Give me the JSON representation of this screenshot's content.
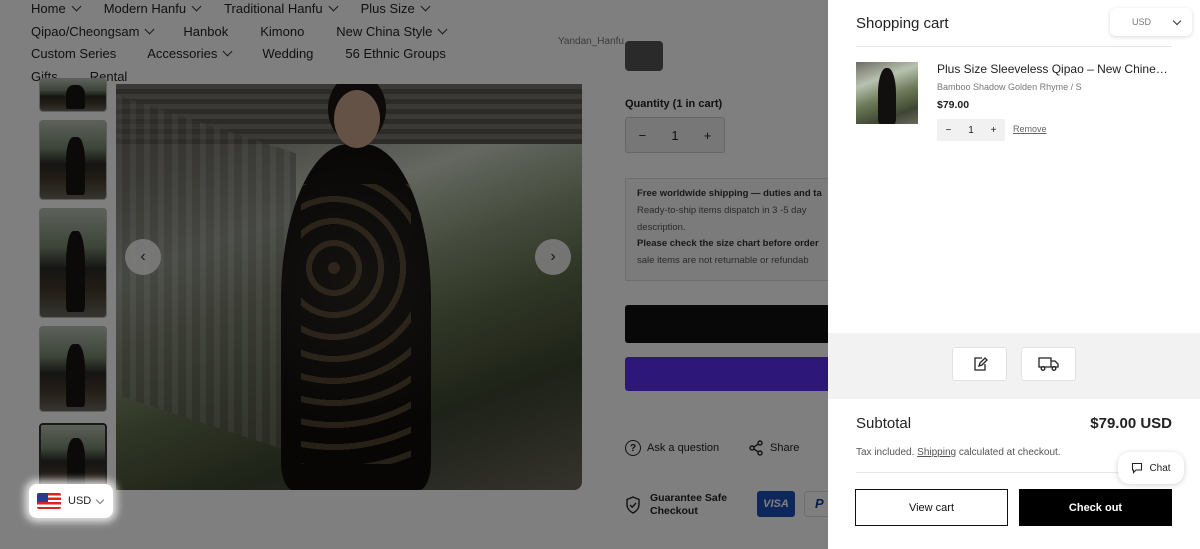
{
  "nav": {
    "row1": [
      {
        "label": "Home",
        "has_dropdown": true
      },
      {
        "label": "Modern Hanfu",
        "has_dropdown": true
      },
      {
        "label": "Traditional Hanfu",
        "has_dropdown": true
      },
      {
        "label": "Plus Size",
        "has_dropdown": true
      }
    ],
    "row2": [
      {
        "label": "Qipao/Cheongsam",
        "has_dropdown": true
      },
      {
        "label": "Hanbok",
        "has_dropdown": false
      },
      {
        "label": "Kimono",
        "has_dropdown": false
      },
      {
        "label": "New China Style",
        "has_dropdown": true
      }
    ],
    "row3": [
      {
        "label": "Custom Series",
        "has_dropdown": false
      },
      {
        "label": "Accessories",
        "has_dropdown": true
      },
      {
        "label": "Wedding",
        "has_dropdown": false
      },
      {
        "label": "56 Ethnic Groups",
        "has_dropdown": false
      }
    ],
    "row4": [
      {
        "label": "Gifts",
        "has_dropdown": false
      },
      {
        "label": "Rental",
        "has_dropdown": false
      }
    ]
  },
  "product": {
    "store_label": "Yandan_Hanfu",
    "quantity_label": "Quantity (1 in cart)",
    "quantity_value": "1",
    "info": {
      "shipping_bold": "Free worldwide shipping — duties and ta",
      "dispatch": "Ready-to-ship items dispatch in 3 -5 day",
      "dispatch_cont": "description.",
      "size_bold": "Please check the size chart before order",
      "returns": "sale items are not returnable or refundab"
    },
    "ask_label": "Ask a question",
    "share_label": "Share",
    "guarantee_line1": "Guarantee Safe",
    "guarantee_line2": "Checkout",
    "visa_label": "VISA",
    "paypal_label": "P"
  },
  "currency_selector": {
    "label": "USD"
  },
  "cart": {
    "title": "Shopping cart",
    "currency": "USD",
    "item": {
      "title": "Plus Size Sleeveless Qipao – New Chinese Style",
      "variant": "Bamboo Shadow Golden Rhyme / S",
      "price": "$79.00",
      "quantity": "1",
      "remove_label": "Remove"
    },
    "subtotal_label": "Subtotal",
    "subtotal_value": "$79.00 USD",
    "tax_prefix": "Tax included.",
    "shipping_link": "Shipping",
    "tax_suffix": "calculated at checkout.",
    "view_cart_label": "View cart",
    "checkout_label": "Check out"
  },
  "chat": {
    "label": "Chat"
  },
  "icons": {
    "minus": "−",
    "plus": "+",
    "prev": "‹",
    "next": "›",
    "question": "?"
  },
  "colors": {
    "overlay": "#000000",
    "checkout_bg": "#000000",
    "shop_pay": "#5a31f4",
    "visa": "#1a4fb8"
  }
}
